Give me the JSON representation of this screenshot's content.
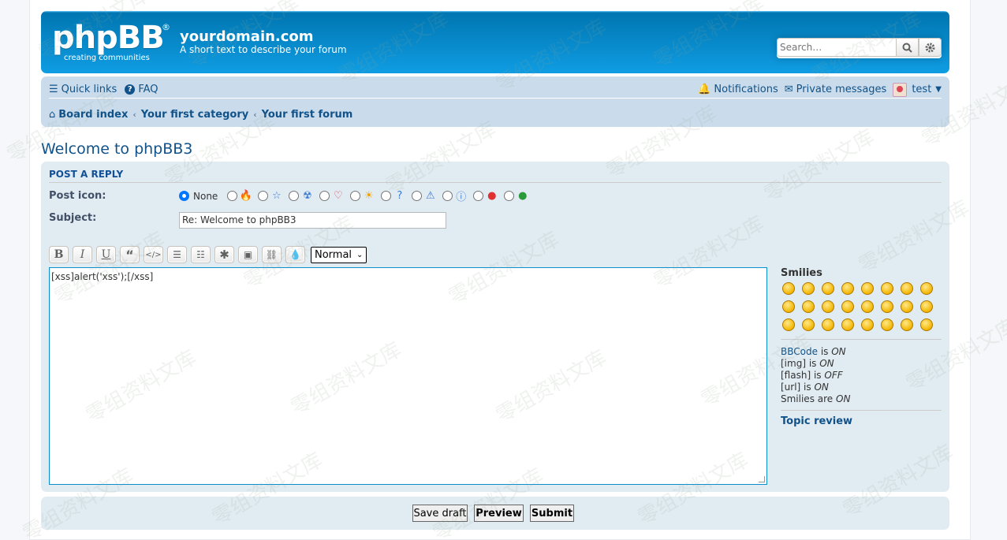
{
  "header": {
    "logo_text": "phpBB",
    "logo_tagline": "creating   communities",
    "site_name": "yourdomain.com",
    "site_description": "A short text to describe your forum",
    "search_placeholder": "Search…"
  },
  "navbar": {
    "quick_links": "Quick links",
    "faq": "FAQ",
    "notifications": "Notifications",
    "private_messages": "Private messages",
    "username": "test",
    "breadcrumbs": [
      "Board index",
      "Your first category",
      "Your first forum"
    ]
  },
  "page_title": "Welcome to phpBB3",
  "form": {
    "header": "POST A REPLY",
    "post_icon_label": "Post icon:",
    "post_icon_none": "None",
    "subject_label": "Subject:",
    "subject_value": "Re: Welcome to phpBB3",
    "font_size_selected": "Normal",
    "message": "[xss]alert('xss');[/xss]"
  },
  "post_icons": [
    "fire-icon",
    "star-icon",
    "radioactive-icon",
    "heart-icon",
    "sun-icon",
    "question-icon",
    "warning-icon",
    "info-icon",
    "alert-icon",
    "thumbs-icon"
  ],
  "smilies": {
    "title": "Smilies",
    "count": 24
  },
  "options": {
    "bbcode_link": "BBCode",
    "bbcode_is": "is",
    "bbcode_state": "ON",
    "img_label": "[img] is",
    "img_state": "ON",
    "flash_label": "[flash] is",
    "flash_state": "OFF",
    "url_label": "[url] is",
    "url_state": "ON",
    "smilies_label": "Smilies are",
    "smilies_state": "ON"
  },
  "topic_review": "Topic review",
  "buttons": {
    "save_draft": "Save draft",
    "preview": "Preview",
    "submit": "Submit"
  },
  "watermark": "零组资料文库",
  "colors": {
    "header_gradient_top": "#0076b1",
    "header_gradient_bottom": "#12a3eb",
    "navbar_bg": "#cadceb",
    "panel_bg": "#e1ebf2",
    "link": "#105289"
  }
}
